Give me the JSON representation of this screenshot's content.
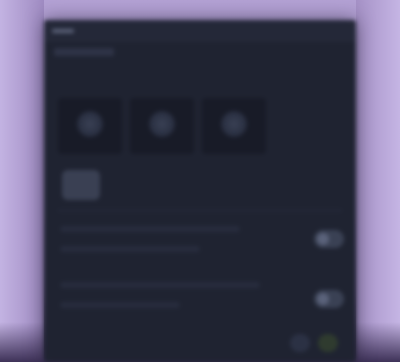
{
  "window": {
    "title": "",
    "subtitle": ""
  },
  "cards": [
    {
      "label": ""
    },
    {
      "label": ""
    },
    {
      "label": ""
    }
  ],
  "profile": {
    "name": ""
  },
  "list": [
    {
      "text": ""
    },
    {
      "text": ""
    },
    {
      "text": ""
    },
    {
      "text": ""
    }
  ],
  "toggles": [
    {
      "state": "off"
    },
    {
      "state": "off"
    }
  ],
  "actions": {
    "secondary_label": "",
    "primary_label": ""
  },
  "colors": {
    "background_lavender": "#b3a1d4",
    "window_bg": "#1f2331",
    "card_bg": "#181b27",
    "accent_green": "#b6d3b0"
  }
}
